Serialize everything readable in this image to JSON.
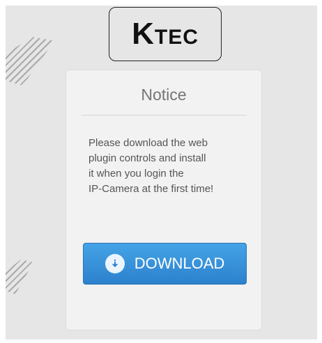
{
  "logo": {
    "first_letter": "K",
    "rest": "TEC"
  },
  "notice": {
    "title": "Notice",
    "message": "Please download the web\nplugin controls and install\nit when you login the\nIP-Camera at the first time!",
    "download_label": "DOWNLOAD",
    "download_icon": "download-arrow-icon"
  },
  "colors": {
    "button_top": "#45a3e6",
    "button_bottom": "#2c81cd",
    "background": "#e6e6e6",
    "panel": "#f2f2f2"
  }
}
